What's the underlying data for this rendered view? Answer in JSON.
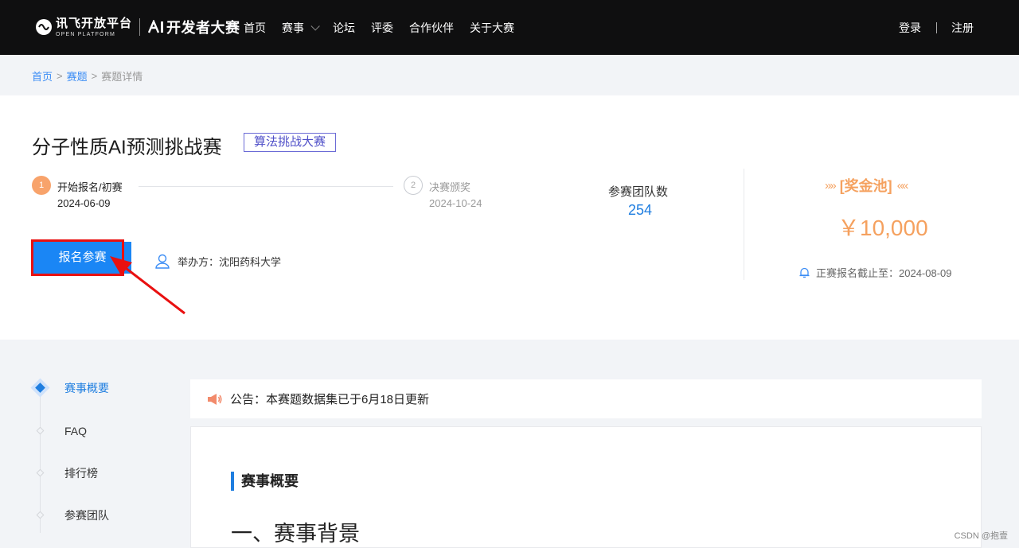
{
  "header": {
    "logo_main": "讯飞开放平台",
    "logo_sub": "OPEN PLATFORM",
    "logo_ai": "开发者大赛",
    "nav": [
      {
        "label": "首页"
      },
      {
        "label": "赛事"
      },
      {
        "label": "论坛"
      },
      {
        "label": "评委"
      },
      {
        "label": "合作伙伴"
      },
      {
        "label": "关于大赛"
      }
    ],
    "login": "登录",
    "register": "注册"
  },
  "breadcrumb": {
    "home": "首页",
    "sep": ">",
    "topics": "赛题",
    "current": "赛题详情"
  },
  "competition": {
    "title": "分子性质AI预测挑战赛",
    "tag": "算法挑战大赛",
    "steps": [
      {
        "num": "1",
        "label": "开始报名/初赛",
        "date": "2024-06-09"
      },
      {
        "num": "2",
        "label": "决赛颁奖",
        "date": "2024-10-24"
      }
    ],
    "teams_label": "参赛团队数",
    "teams_count": "254",
    "prize_title": "[奖金池]",
    "prize_arrows_left": "»»",
    "prize_arrows_right": "««",
    "prize_amount": "￥10,000",
    "deadline": "正赛报名截止至：2024-08-09",
    "signup_button": "报名参赛",
    "organizer": "举办方：沈阳药科大学"
  },
  "sidenav": [
    {
      "label": "赛事概要",
      "active": true
    },
    {
      "label": "FAQ",
      "active": false
    },
    {
      "label": "排行榜",
      "active": false
    },
    {
      "label": "参赛团队",
      "active": false
    }
  ],
  "notice": "公告：本赛题数据集已于6月18日更新",
  "content": {
    "section": "赛事概要",
    "heading": "一、赛事背景"
  },
  "watermark": "CSDN @抱壹",
  "colors": {
    "accent": "#1a86f5",
    "prize": "#f5a15f",
    "annotation": "#e91010"
  }
}
